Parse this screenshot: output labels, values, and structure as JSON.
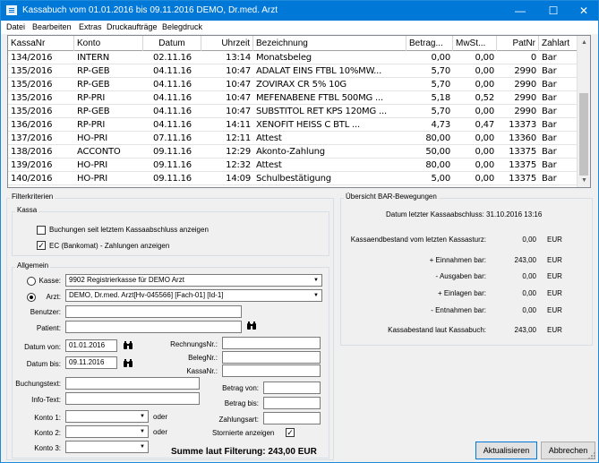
{
  "window": {
    "title": "Kassabuch vom 01.01.2016 bis 09.11.2016 DEMO, Dr.med. Arzt",
    "minimize": "—",
    "maximize": "☐",
    "close": "✕"
  },
  "menu": [
    "Datei",
    "Bearbeiten",
    "Extras",
    "Druckaufträge",
    "Belegdruck"
  ],
  "grid": {
    "columns": [
      "KassaNr",
      "Konto",
      "Datum",
      "Uhrzeit",
      "Bezeichnung",
      "Betrag...",
      "MwSt...",
      "PatNr",
      "Zahlart"
    ],
    "rows": [
      [
        "134/2016",
        "INTERN",
        "02.11.16",
        "13:14",
        "Monatsbeleg",
        "0,00",
        "0,00",
        "0",
        "Bar"
      ],
      [
        "135/2016",
        "RP-GEB",
        "04.11.16",
        "10:47",
        "ADALAT EINS FTBL 10%MW...",
        "5,70",
        "0,00",
        "2990",
        "Bar"
      ],
      [
        "135/2016",
        "RP-GEB",
        "04.11.16",
        "10:47",
        "ZOVIRAX CR 5%          10G",
        "5,70",
        "0,00",
        "2990",
        "Bar"
      ],
      [
        "135/2016",
        "RP-PRI",
        "04.11.16",
        "10:47",
        "MEFENABENE FTBL 500MG ...",
        "5,18",
        "0,52",
        "2990",
        "Bar"
      ],
      [
        "135/2016",
        "RP-GEB",
        "04.11.16",
        "10:47",
        "SUBSTITOL RET KPS 120MG ...",
        "5,70",
        "0,00",
        "2990",
        "Bar"
      ],
      [
        "136/2016",
        "RP-PRI",
        "04.11.16",
        "14:11",
        "XENOFIT HEISS C       BTL ...",
        "4,73",
        "0,47",
        "13373",
        "Bar"
      ],
      [
        "137/2016",
        "HO-PRI",
        "07.11.16",
        "12:11",
        "Attest",
        "80,00",
        "0,00",
        "13360",
        "Bar"
      ],
      [
        "138/2016",
        "ACCONTO",
        "09.11.16",
        "12:29",
        "Akonto-Zahlung",
        "50,00",
        "0,00",
        "13375",
        "Bar"
      ],
      [
        "139/2016",
        "HO-PRI",
        "09.11.16",
        "12:32",
        "Attest",
        "80,00",
        "0,00",
        "13375",
        "Bar"
      ],
      [
        "140/2016",
        "HO-PRI",
        "09.11.16",
        "14:09",
        "Schulbestätigung",
        "5,00",
        "0,00",
        "13375",
        "Bar"
      ]
    ],
    "scroll_up": "▲",
    "scroll_down": "▼"
  },
  "filter": {
    "title": "Filterkriterien",
    "kassa_group": "Kassa",
    "chk_since_close": "Buchungen seit letztem Kassaabschluss anzeigen",
    "chk_since_close_checked": false,
    "chk_ec": "EC (Bankomat) - Zahlungen anzeigen",
    "chk_ec_checked": true,
    "allgemein_group": "Allgemein",
    "kasse_label": "Kasse:",
    "kasse_value": "9902  Registrierkasse für DEMO Arzt",
    "arzt_label": "Arzt:",
    "arzt_value": "DEMO, Dr.med. Arzt[Hv-045566] [Fach-01] [Id-1]",
    "benutzer_label": "Benutzer:",
    "patient_label": "Patient:",
    "datum_von_label": "Datum von:",
    "datum_von": "01.01.2016",
    "datum_bis_label": "Datum bis:",
    "datum_bis": "09.11.2016",
    "rechnungsnr_label": "RechnungsNr.:",
    "belegnr_label": "BelegNr.:",
    "kassanr_label": "KassaNr.:",
    "buchungstext_label": "Buchungstext:",
    "infotext_label": "Info-Text:",
    "betrag_von_label": "Betrag von:",
    "betrag_bis_label": "Betrag bis:",
    "zahlungsart_label": "Zahlungsart:",
    "konto1_label": "Konto 1:",
    "konto2_label": "Konto 2:",
    "konto3_label": "Konto 3:",
    "oder": "oder",
    "storniert_label": "Stornierte anzeigen",
    "storniert_checked": true,
    "summe": "Summe laut Filterung: 243,00 EUR",
    "check_mark": "✓",
    "arrow": "▼"
  },
  "bar": {
    "title": "Übersicht BAR-Bewegungen",
    "last_close": "Datum letzter Kassaabschluss: 31.10.2016 13:16",
    "rows": [
      {
        "label": "Kassaendbestand vom letzten Kassasturz:",
        "value": "0,00",
        "cur": "EUR"
      },
      {
        "label": "+ Einnahmen bar:",
        "value": "243,00",
        "cur": "EUR"
      },
      {
        "label": "- Ausgaben bar:",
        "value": "0,00",
        "cur": "EUR"
      },
      {
        "label": "+ Einlagen bar:",
        "value": "0,00",
        "cur": "EUR"
      },
      {
        "label": "- Entnahmen bar:",
        "value": "0,00",
        "cur": "EUR"
      },
      {
        "label": "Kassabestand laut Kassabuch:",
        "value": "243,00",
        "cur": "EUR"
      }
    ]
  },
  "buttons": {
    "refresh": "Aktualisieren",
    "cancel": "Abbrechen"
  }
}
